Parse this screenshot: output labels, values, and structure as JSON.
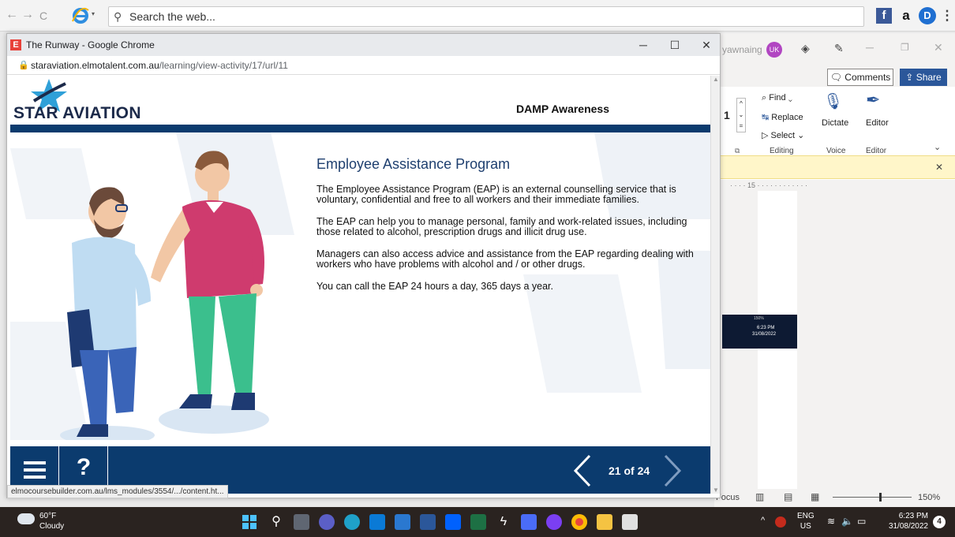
{
  "topbar": {
    "back": "←",
    "forward": "→",
    "refresh": "C",
    "search_placeholder": "Search the web..."
  },
  "word": {
    "user_text": "yawnaing",
    "avatar": "UK",
    "comments_label": "Comments",
    "share_label": "Share",
    "find_label": "Find",
    "replace_label": "Replace",
    "select_label": "Select",
    "editing_label": "Editing",
    "dictate_label": "Dictate",
    "voice_label": "Voice",
    "editor_label": "Editor",
    "editor_group_label": "Editor",
    "ruler_text": "15",
    "focus_label": "Focus",
    "zoom_label": "150%",
    "font_size_value": "1",
    "mini_time": "6:23 PM",
    "mini_date": "31/08/2022",
    "mini_zoom": "150%"
  },
  "chrome": {
    "title": "The Runway - Google Chrome",
    "url_domain": "staraviation.elmotalent.com.au",
    "url_path": "/learning/view-activity/17/url/11",
    "status_url": "elmocoursebuilder.com.au/lms_modules/3554/.../content.ht..."
  },
  "course": {
    "logo_text": "STAR AVIATION",
    "header_title": "DAMP Awareness",
    "section_title": "Employee Assistance Program",
    "paragraphs": [
      "The Employee Assistance Program (EAP) is an external counselling service that is voluntary, confidential and free to all workers and their immediate families.",
      "The EAP can help you to manage personal, family and work-related issues, including those related to alcohol, prescription drugs and illicit drug use.",
      "Managers can also access advice and assistance from the EAP regarding dealing with workers who have problems with alcohol and / or other drugs.",
      "You can call the EAP 24 hours a day, 365 days a year."
    ],
    "help_label": "?",
    "page_count": "21 of 24"
  },
  "taskbar": {
    "temperature": "60°F",
    "weather": "Cloudy",
    "lang_top": "ENG",
    "lang_bottom": "US",
    "time": "6:23 PM",
    "date": "31/08/2022",
    "notifications": "4"
  },
  "colors": {
    "brand_navy": "#0b3b6e",
    "title_blue": "#1e3f6f",
    "banner_yellow": "#fff6c9"
  }
}
